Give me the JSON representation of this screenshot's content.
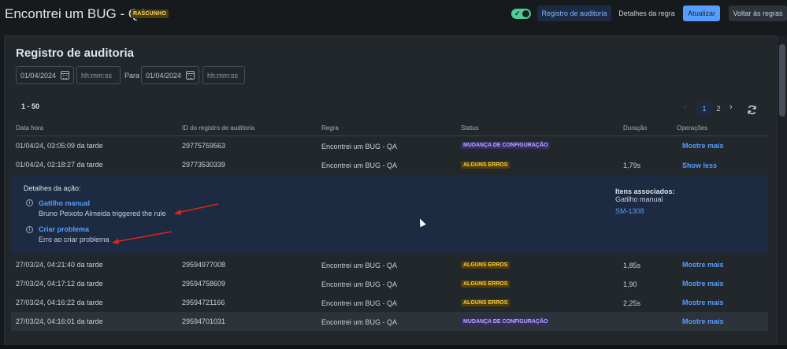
{
  "header": {
    "title": "Encontrei um BUG - QA",
    "badge": "RASCUNHO",
    "toggle_on": true,
    "buttons": {
      "audit_log": "Registro de auditoria",
      "rule_details": "Detalhes da regra",
      "update": "Atualizar",
      "back": "Voltar às regras"
    }
  },
  "audit": {
    "title": "Registro de auditoria",
    "from_date": "01/04/2024",
    "from_time_placeholder": "hh:mm:ss",
    "to_label": "Para",
    "to_date": "01/04/2024",
    "to_time_placeholder": "hh:mm:ss",
    "range": "1 - 50",
    "pages": [
      "1",
      "2"
    ],
    "current_page": "1"
  },
  "table": {
    "columns": [
      "Data hora",
      "ID do registro de auditoria",
      "Regra",
      "Status",
      "Duração",
      "Operações"
    ],
    "rows": [
      {
        "datetime": "01/04/24, 03:05:09 da tarde",
        "id": "29775759563",
        "rule": "Encontrei um BUG - QA",
        "status": "MUDANÇA DE CONFIGURAÇÃO",
        "duration": "",
        "operation": "Mostre mais"
      },
      {
        "datetime": "01/04/24, 02:18:27 da tarde",
        "id": "29773530339",
        "rule": "Encontrei um BUG - QA",
        "status": "ALGUNS ERROS",
        "duration": "1,79s",
        "operation": "Show less"
      },
      {
        "datetime": "27/03/24, 04:21:40 da tarde",
        "id": "29594977008",
        "rule": "Encontrei um BUG - QA",
        "status": "ALGUNS ERROS",
        "duration": "1,85s",
        "operation": "Mostre mais"
      },
      {
        "datetime": "27/03/24, 04:17:12 da tarde",
        "id": "29594758609",
        "rule": "Encontrei um BUG - QA",
        "status": "ALGUNS ERROS",
        "duration": "1,90",
        "operation": "Mostre mais"
      },
      {
        "datetime": "27/03/24, 04:16:22 da tarde",
        "id": "29594721166",
        "rule": "Encontrei um BUG - QA",
        "status": "ALGUNS ERROS",
        "duration": "2,25s",
        "operation": "Mostre mais"
      },
      {
        "datetime": "27/03/24, 04:16:01 da tarde",
        "id": "29594701031",
        "rule": "Encontrei um BUG - QA",
        "status": "MUDANÇA DE CONFIGURAÇÃO",
        "duration": "",
        "operation": "Mostre mais"
      }
    ]
  },
  "details": {
    "heading": "Detalhes da ação:",
    "actions": [
      {
        "title": "Gatilho manual",
        "message": "Bruno Peixoto Almeida triggered the rule"
      },
      {
        "title": "Criar problema",
        "message": "Erro ao criar problema"
      }
    ],
    "associated_heading": "Itens associados:",
    "associated_type": "Gatilho manual",
    "associated_link": "SM-1308"
  },
  "colors": {
    "page_bg": "#161a1d",
    "panel_bg": "#22272b",
    "details_bg": "#1c2b41",
    "link": "#579dff",
    "annotation_arrow": "#e2231a"
  }
}
